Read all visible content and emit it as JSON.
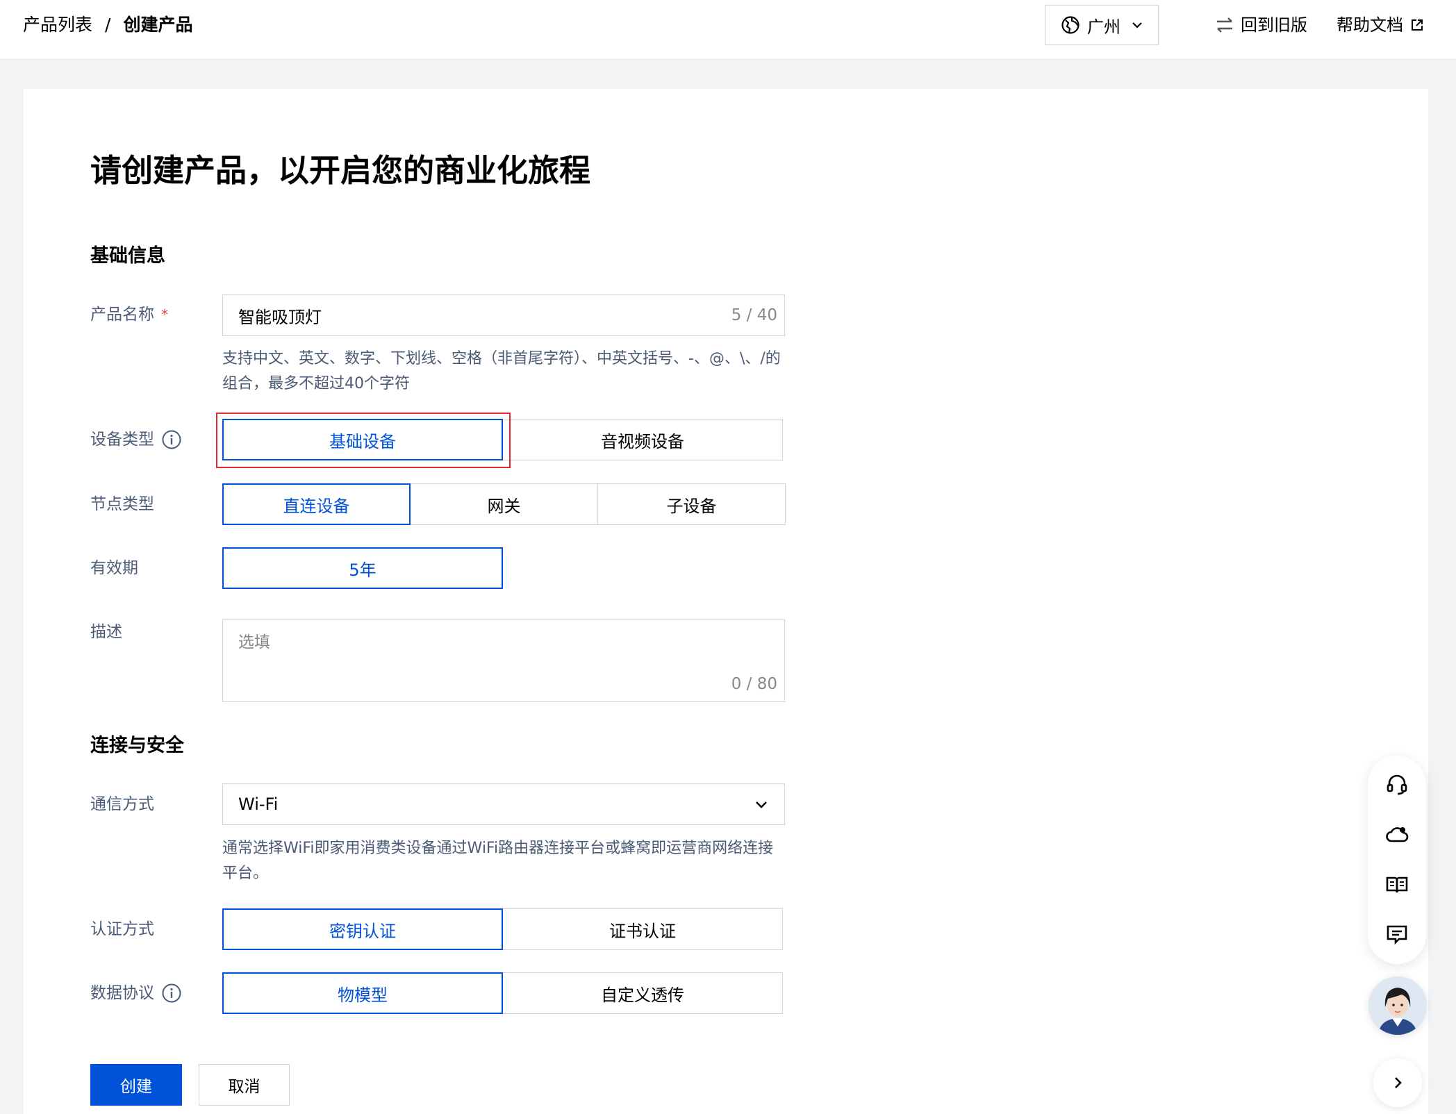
{
  "breadcrumb": {
    "parent": "产品列表",
    "separator": "/",
    "current": "创建产品"
  },
  "header": {
    "region": "广州",
    "old_version": "回到旧版",
    "help_doc": "帮助文档"
  },
  "page_title": "请创建产品，以开启您的商业化旅程",
  "basic_section": {
    "title": "基础信息",
    "product_name": {
      "label": "产品名称",
      "required_mark": "*",
      "value": "智能吸顶灯",
      "counter": "5 / 40",
      "hint": "支持中文、英文、数字、下划线、空格（非首尾字符）、中英文括号、-、@、\\、/的组合，最多不超过40个字符"
    },
    "device_type": {
      "label": "设备类型",
      "options": [
        "基础设备",
        "音视频设备"
      ],
      "selected": "基础设备"
    },
    "node_type": {
      "label": "节点类型",
      "options": [
        "直连设备",
        "网关",
        "子设备"
      ],
      "selected": "直连设备"
    },
    "validity": {
      "label": "有效期",
      "options": [
        "5年"
      ],
      "selected": "5年"
    },
    "description": {
      "label": "描述",
      "placeholder": "选填",
      "counter": "0 / 80"
    }
  },
  "security_section": {
    "title": "连接与安全",
    "comm_method": {
      "label": "通信方式",
      "value": "Wi-Fi",
      "hint": "通常选择WiFi即家用消费类设备通过WiFi路由器连接平台或蜂窝即运营商网络连接平台。"
    },
    "auth_method": {
      "label": "认证方式",
      "options": [
        "密钥认证",
        "证书认证"
      ],
      "selected": "密钥认证"
    },
    "data_protocol": {
      "label": "数据协议",
      "options": [
        "物模型",
        "自定义透传"
      ],
      "selected": "物模型"
    }
  },
  "actions": {
    "create": "创建",
    "cancel": "取消"
  },
  "float_tools": [
    "headset-icon",
    "cloud-icon",
    "book-icon",
    "feedback-icon"
  ],
  "colors": {
    "primary": "#0052d9",
    "highlight": "#e5262e",
    "required": "#e54545"
  }
}
